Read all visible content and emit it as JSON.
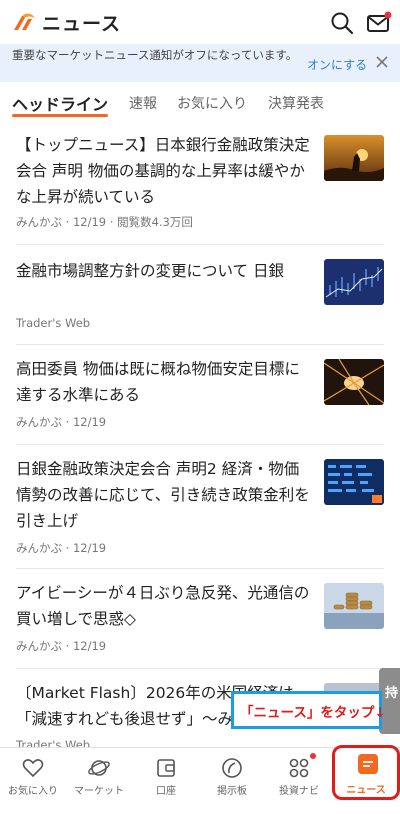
{
  "header": {
    "title": "ニュース",
    "logo_icon": "company-logo",
    "search_icon": "search-icon",
    "mail_icon": "mail-icon",
    "accent": "#f26a22",
    "notification_dot_color": "#e8333b"
  },
  "banner": {
    "text": "重要なマーケットニュース通知がオフになっています。",
    "action_label": "オンにする",
    "close_icon": "close-icon",
    "background": "#e7f0fb",
    "action_color": "#2f7fd6"
  },
  "tabs": [
    {
      "label": "ヘッドライン",
      "active": true
    },
    {
      "label": "速報",
      "active": false
    },
    {
      "label": "お気に入り",
      "active": false
    },
    {
      "label": "決算発表",
      "active": false
    }
  ],
  "news": [
    {
      "title": "【トップニュース】日本銀行金融政策決定会合 声明 物価の基調的な上昇率は緩やかな上昇が続いている",
      "meta": "みんかぶ · 12/19 · 閲覧数4.3万回",
      "thumb": "sunset-silhouette"
    },
    {
      "title": "金融市場調整方針の変更について 日銀",
      "meta": "Trader's Web",
      "thumb": "stock-chart"
    },
    {
      "title": "高田委員 物価は既に概ね物価安定目標に達する水準にある",
      "meta": "みんかぶ · 12/19",
      "thumb": "tunnel-lights"
    },
    {
      "title": "日銀金融政策決定会合 声明2 経済・物価情勢の改善に応じて、引き続き政策金利を引き上げ",
      "meta": "みんかぶ · 12/19",
      "thumb": "market-board"
    },
    {
      "title": "アイビーシーが４日ぶり急反発、光通信の買い増しで思惑◇",
      "meta": "みんかぶ · 12/19",
      "thumb": "coin-stacks"
    },
    {
      "title": "〔Market Flash〕2026年の米国経済は「減速すれども後退せず」～み",
      "meta": "Trader's Web",
      "thumb": "chart-thumbnail"
    }
  ],
  "side_fragment": {
    "text": "持"
  },
  "callout": {
    "text": "「ニュース」をタップ↓"
  },
  "bottom_nav": [
    {
      "label": "お気に入り",
      "icon": "heart-icon"
    },
    {
      "label": "マーケット",
      "icon": "planet-icon"
    },
    {
      "label": "口座",
      "icon": "wallet-icon"
    },
    {
      "label": "掲示板",
      "icon": "board-icon"
    },
    {
      "label": "投資ナビ",
      "icon": "grid-icon",
      "dot": true
    },
    {
      "label": "ニュース",
      "icon": "news-icon",
      "active": true
    }
  ]
}
